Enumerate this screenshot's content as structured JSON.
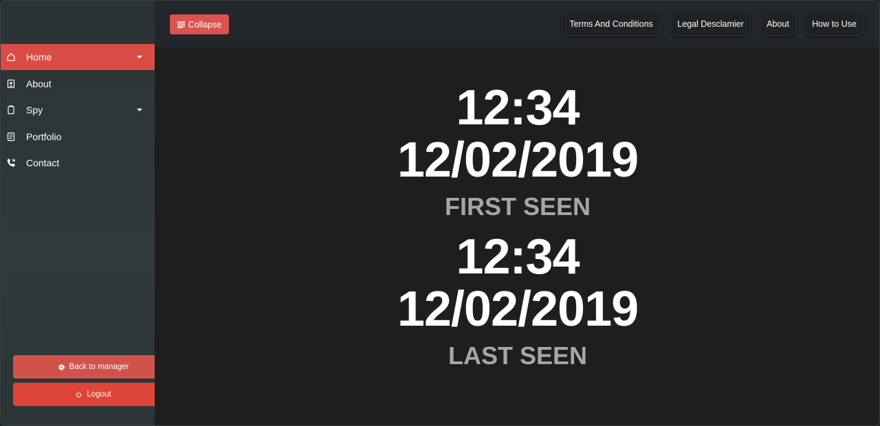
{
  "sidebar": {
    "items": [
      {
        "label": "Home",
        "icon": "home-icon",
        "active": true,
        "has_caret": true
      },
      {
        "label": "About",
        "icon": "id-badge-icon",
        "active": false,
        "has_caret": false
      },
      {
        "label": "Spy",
        "icon": "copy-icon",
        "active": false,
        "has_caret": true
      },
      {
        "label": "Portfolio",
        "icon": "document-icon",
        "active": false,
        "has_caret": false
      },
      {
        "label": "Contact",
        "icon": "phone-icon",
        "active": false,
        "has_caret": false
      }
    ],
    "back_to_manager_label": "Back to manager",
    "logout_label": "Logout"
  },
  "topbar": {
    "collapse_label": "Collapse",
    "links": [
      {
        "label": "Terms And Conditions"
      },
      {
        "label": "Legal Desclamier"
      },
      {
        "label": "About"
      },
      {
        "label": "How to Use"
      }
    ]
  },
  "main": {
    "first_seen": {
      "time": "12:34",
      "date": "12/02/2019",
      "caption": "FIRST SEEN"
    },
    "last_seen": {
      "time": "12:34",
      "date": "12/02/2019",
      "caption": "LAST SEEN"
    }
  },
  "colors": {
    "accent": "#d9534f",
    "logout": "#df4438",
    "sidebar_bg": "#2f3a3c",
    "main_bg": "#1e1e1f",
    "caption": "#a6a6a6"
  }
}
